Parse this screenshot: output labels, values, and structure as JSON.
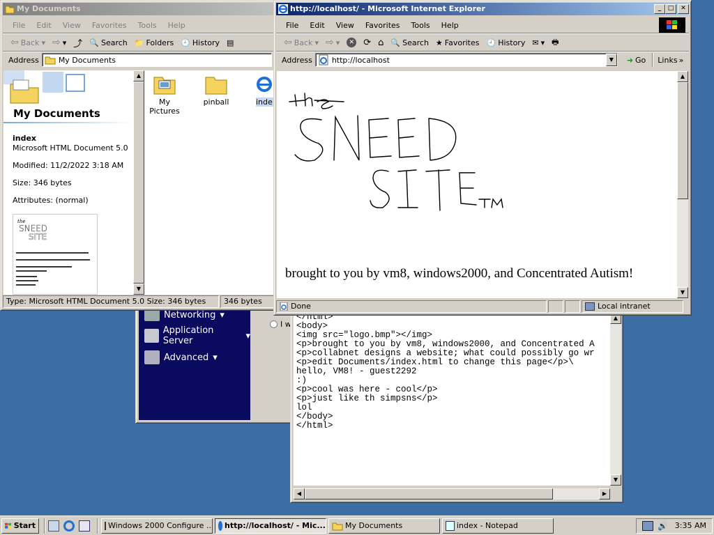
{
  "mydocs": {
    "title": "My Documents",
    "menu": [
      "File",
      "Edit",
      "View",
      "Favorites",
      "Tools",
      "Help"
    ],
    "toolbar": {
      "back": "Back",
      "search": "Search",
      "folders": "Folders",
      "history": "History"
    },
    "address_label": "Address",
    "address_value": "My Documents",
    "panel_title": "My Documents",
    "selected_name": "index",
    "selected_type": "Microsoft HTML Document 5.0",
    "modified": "Modified: 11/2/2022 3:18 AM",
    "size": "Size: 346 bytes",
    "attributes": "Attributes: (normal)",
    "files": [
      {
        "name": "My Pictures",
        "icon": "folder-pictures-icon"
      },
      {
        "name": "pinball",
        "icon": "folder-icon"
      },
      {
        "name": "inde",
        "icon": "ie-document-icon"
      }
    ],
    "status_left": "Type: Microsoft HTML Document 5.0 Size: 346 bytes",
    "status_right": "346 bytes"
  },
  "config": {
    "nav": [
      "Networking",
      "Application Server",
      "Advanced"
    ],
    "radio_label": "I w"
  },
  "notepad": {
    "lines": [
      "</html>",
      "<body>",
      "<img src=\"logo.bmp\"></img>",
      "<p>brought to you by vm8, windows2000, and Concentrated A",
      "<p>collabnet designs a website; what could possibly go wr",
      "<p>edit Documents/index.html to change this page</p>\\",
      "hello, VM8! - guest2292",
      ":)",
      "<p>cool was here - cool</p>",
      "<p>just like th simpsns</p>",
      "lol",
      "</body>",
      "</html>"
    ]
  },
  "ie": {
    "title": "http://localhost/ - Microsoft Internet Explorer",
    "menu": [
      "File",
      "Edit",
      "View",
      "Favorites",
      "Tools",
      "Help"
    ],
    "toolbar": {
      "back": "Back",
      "search": "Search",
      "favorites": "Favorites",
      "history": "History"
    },
    "address_label": "Address",
    "address_value": "http://localhost",
    "go": "Go",
    "links": "Links",
    "page_text": "brought to you by vm8, windows2000, and Concentrated Autism!",
    "status_done": "Done",
    "status_zone": "Local intranet"
  },
  "taskbar": {
    "start": "Start",
    "items": [
      {
        "label": "Windows 2000 Configure ...",
        "pressed": false
      },
      {
        "label": "http://localhost/ - Mic...",
        "pressed": true
      },
      {
        "label": "My Documents",
        "pressed": false
      },
      {
        "label": "index - Notepad",
        "pressed": false
      }
    ],
    "clock": "3:35 AM"
  }
}
